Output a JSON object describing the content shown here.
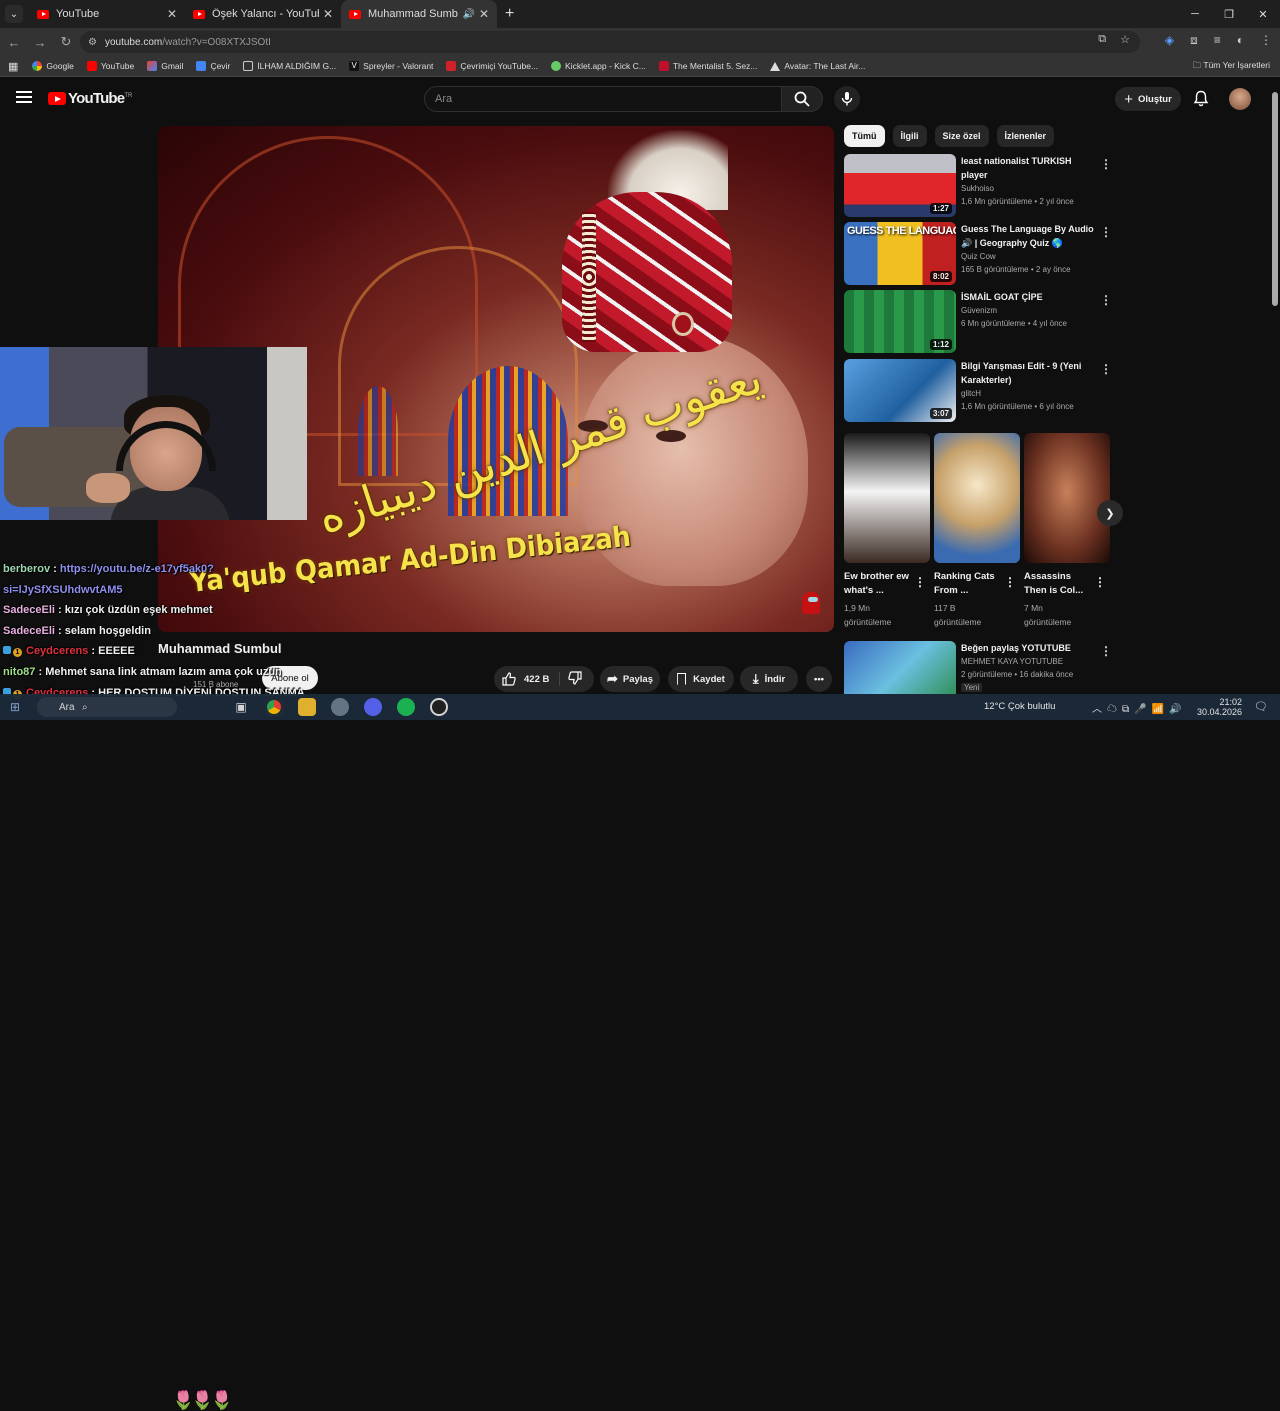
{
  "browser": {
    "tabs": [
      {
        "title": "YouTube",
        "active": false
      },
      {
        "title": "Öşek Yalancı - YouTube",
        "active": false
      },
      {
        "title": "Muhammad Sumbul - YouT",
        "active": true
      }
    ],
    "url_host": "youtube.com",
    "url_path": "/watch?v=O08XTXJSOtI",
    "bookmarks": [
      "Google",
      "YouTube",
      "Gmail",
      "Çevir",
      "İLHAM ALDIĞIM G...",
      "Spreyler - Valorant",
      "Çevrimiçi YouTube...",
      "Kicklet.app - Kick C...",
      "The Mentalist 5. Sez...",
      "Avatar: The Last Air..."
    ],
    "bookmarks_right": "Tüm Yer İşaretleri"
  },
  "youtube": {
    "logo_text": "YouTube",
    "logo_region": "TR",
    "search_placeholder": "Ara",
    "create_label": "Oluştur"
  },
  "video": {
    "title": "Muhammad Sumbul",
    "arabic_caption": "يعقوب قمر الدين ديبيازه",
    "caption": "Ya'qub Qamar Ad-Din Dibiazah",
    "subscribers": "151 B abone",
    "subscribe_label": "Abone ol",
    "likes": "422 B",
    "share_label": "Paylaş",
    "save_label": "Kaydet",
    "download_label": "İndir"
  },
  "chat": [
    {
      "user": "berberov",
      "text": "https://youtu.be/z-e17yf5ak0?",
      "link": true
    },
    {
      "user": "",
      "text": "si=lJySfXSUhdwvtAM5",
      "link": true
    },
    {
      "user": "SadeceEli",
      "text": "kızı çok üzdün eşek mehmet"
    },
    {
      "user": "SadeceEli",
      "text": "selam hoşgeldin"
    },
    {
      "user": "Ceydcerens",
      "text": "EEEEE"
    },
    {
      "user": "nito87",
      "text": "Mehmet sana link atmam lazım ama çok uzun"
    },
    {
      "user": "Ceydcerens",
      "text": "HER DOSTUM DİYENİ DOSTUN SANMA"
    }
  ],
  "sidebar": {
    "chips": [
      "Tümü",
      "İlgili",
      "Size özel",
      "İzlenenler"
    ],
    "recommendations": [
      {
        "title": "least nationalist TURKISH player",
        "channel": "Sukhoiso",
        "meta": "1,6 Mn görüntüleme • 2 yıl önce",
        "duration": "1:27"
      },
      {
        "title": "Guess The Language By Audio 🔊 | Geography Quiz 🌎",
        "channel": "Quiz Cow",
        "meta": "165 B görüntüleme • 2 ay önce",
        "duration": "8:02",
        "thumb_text": "GUESS THE LANGUAGE"
      },
      {
        "title": "İSMAİL GOAT ÇİPE",
        "channel": "Güvenizm",
        "meta": "6 Mn görüntüleme • 4 yıl önce",
        "duration": "1:12"
      },
      {
        "title": "Bilgi Yarışması Edit - 9 (Yeni Karakterler)",
        "channel": "glitcH",
        "meta": "1,6 Mn görüntüleme • 6 yıl önce",
        "duration": "3:07"
      }
    ],
    "shorts": [
      {
        "title": "Ew brother ew what's ...",
        "views": "1,9 Mn",
        "label": "görüntüleme"
      },
      {
        "title": "Ranking Cats From ...",
        "views": "117 B",
        "label": "görüntüleme"
      },
      {
        "title": "Assassins Then is Col...",
        "views": "7 Mn",
        "label": "görüntüleme"
      }
    ],
    "bottom_rec": {
      "title": "Beğen paylaş YOTUTUBE",
      "channel": "MEHMET KAYA YOTUTUBE",
      "meta": "2 görüntüleme • 16 dakika önce",
      "badge": "Yeni"
    }
  },
  "taskbar": {
    "search": "Ara",
    "weather": "12°C  Çok bulutlu",
    "time": "21:02",
    "date": "30.04.2026"
  }
}
